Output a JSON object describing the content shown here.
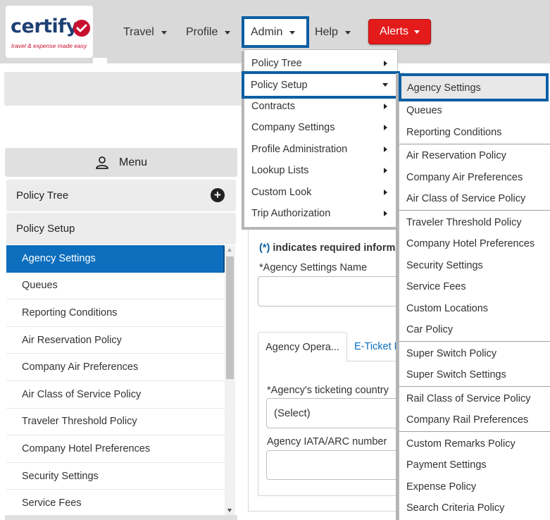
{
  "logo": {
    "name": "certify",
    "tagline": "travel & expense made easy"
  },
  "nav": {
    "travel": "Travel",
    "profile": "Profile",
    "admin": "Admin",
    "help": "Help",
    "alerts": "Alerts"
  },
  "colors": {
    "brand_blue": "#1e3f74",
    "accent_blue": "#0b5fa3",
    "alert_red": "#e41b1b",
    "active_item": "#0d6ebd"
  },
  "left_panel": {
    "menu_title": "Menu",
    "sections": [
      "Policy Tree",
      "Policy Setup"
    ],
    "items": [
      "Agency Settings",
      "Queues",
      "Reporting Conditions",
      "Air Reservation Policy",
      "Company Air Preferences",
      "Air Class of Service Policy",
      "Traveler Threshold Policy",
      "Company Hotel Preferences",
      "Security Settings",
      "Service Fees"
    ]
  },
  "form": {
    "required_star": "(*)",
    "required_note": "indicates required informa",
    "settings_name_label": "*Agency Settings Name",
    "tab_active": "Agency Opera...",
    "tab_inactive": "E-Ticket R",
    "ticketing_country_label": "*Agency's ticketing country",
    "ticketing_country_value": "(Select)",
    "iata_label": "Agency IATA/ARC number"
  },
  "admin_menu": {
    "items": [
      "Policy Tree",
      "Policy Setup",
      "Contracts",
      "Company Settings",
      "Profile Administration",
      "Lookup Lists",
      "Custom Look",
      "Trip Authorization"
    ]
  },
  "policy_setup_submenu": {
    "items": [
      "Agency Settings",
      "Queues",
      "Reporting Conditions",
      "Air Reservation Policy",
      "Company Air Preferences",
      "Air Class of Service Policy",
      "Traveler Threshold Policy",
      "Company Hotel Preferences",
      "Security Settings",
      "Service Fees",
      "Custom Locations",
      "Car Policy",
      "Super Switch Policy",
      "Super Switch Settings",
      "Rail Class of Service Policy",
      "Company Rail Preferences",
      "Custom Remarks Policy",
      "Payment Settings",
      "Expense Policy",
      "Search Criteria Policy"
    ]
  }
}
